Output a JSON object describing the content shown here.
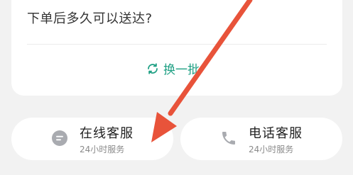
{
  "faq": {
    "question": "下单后多久可以送达?",
    "refresh_label": "换一批",
    "refresh_icon": "refresh-icon"
  },
  "contacts": {
    "online": {
      "title": "在线客服",
      "subtitle": "24小时服务",
      "icon": "chat-bubble-icon"
    },
    "phone": {
      "title": "电话客服",
      "subtitle": "24小时服务",
      "icon": "phone-icon"
    }
  },
  "colors": {
    "page_background": "#f2f2f2",
    "card_background": "#ffffff",
    "accent_green": "#1fa084",
    "annotation_arrow": "#e8533a",
    "icon_grey": "#a9abb0"
  }
}
